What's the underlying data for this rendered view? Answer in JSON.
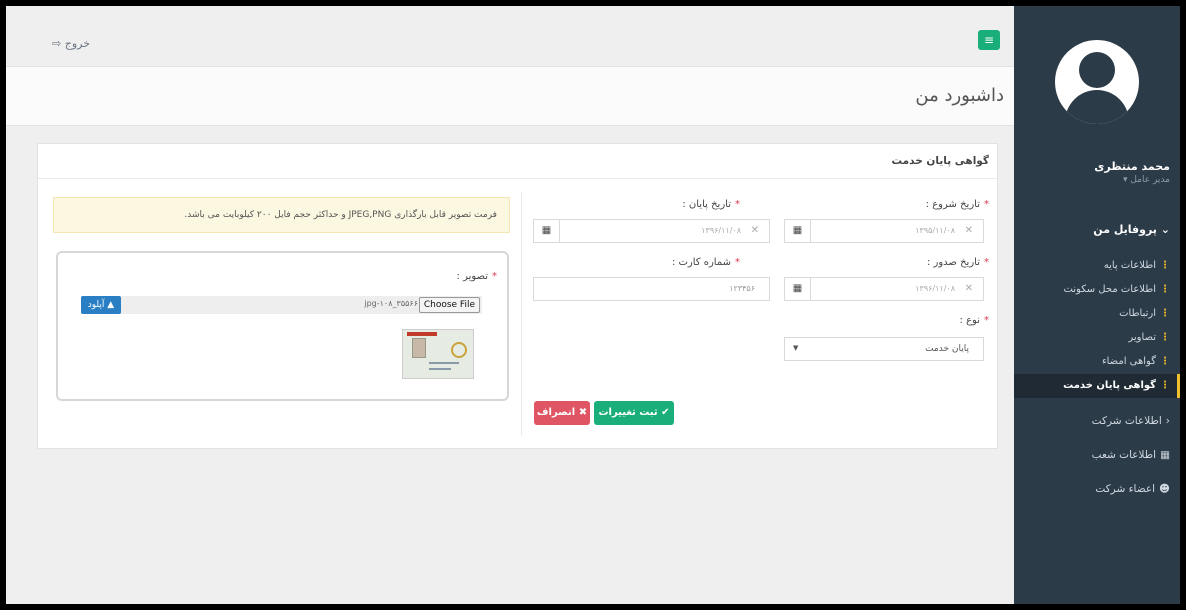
{
  "topbar": {
    "menu_icon": "bars-icon",
    "logout_label": "خروج",
    "logout_icon": "sign-out-icon"
  },
  "page": {
    "title": "داشبورد من"
  },
  "sidebar": {
    "user_name": "محمد منتظری",
    "user_role": "مدیر عامل",
    "profile_header": "پروفایل من",
    "profile_items": [
      {
        "label": "اطلاعات پایه"
      },
      {
        "label": "اطلاعات محل سکونت"
      },
      {
        "label": "ارتباطات"
      },
      {
        "label": "تصاویر"
      },
      {
        "label": "گواهی امضاء"
      },
      {
        "label": "گواهی پایان خدمت",
        "active": true
      }
    ],
    "company_info": "اطلاعات شرکت",
    "branches": "اطلاعات شعب",
    "members": "اعضاء شرکت"
  },
  "form": {
    "panel_title": "گواهی پایان خدمت",
    "start_date_label": "تاریخ شروع :",
    "start_date_value": "۱۳۹۵/۱۱/۰۸",
    "end_date_label": "تاریخ پایان :",
    "end_date_value": "۱۳۹۶/۱۱/۰۸",
    "issue_date_label": "تاریخ صدور :",
    "issue_date_value": "۱۳۹۶/۱۱/۰۸",
    "card_number_label": "شماره کارت :",
    "card_number_value": "۱۲۳۴۵۶",
    "type_label": "نوع :",
    "type_value": "پایان خدمت",
    "save_label": "ثبت تغییرات",
    "cancel_label": "انصراف",
    "alert_text": "فرمت تصویر قابل بارگذاری JPEG,PNG و حداکثر حجم فایل ۲۰۰ کیلوبایت می باشد.",
    "image_label": "تصویر :",
    "choose_file_label": "Choose File",
    "file_name": "jpg-۱۰۸_۳۵۵۶۶",
    "upload_label": "آپلود"
  },
  "colors": {
    "sidebar_bg": "#2c3b48",
    "primary_green": "#1aaf7a",
    "danger_red": "#e05563",
    "upload_blue": "#2a7fc4",
    "required_star": "#e0354a"
  }
}
